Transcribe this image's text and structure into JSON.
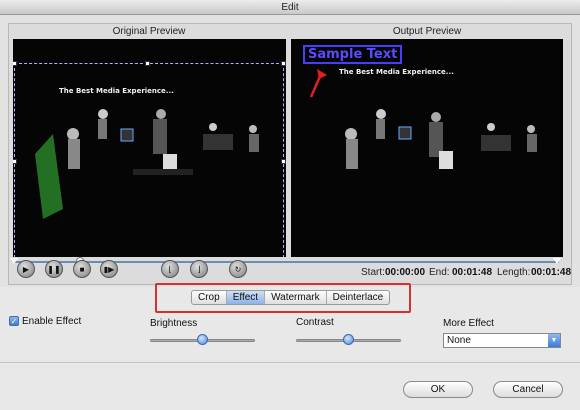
{
  "window": {
    "title": "Edit"
  },
  "preview": {
    "original_label": "Original Preview",
    "output_label": "Output Preview",
    "video_caption": "The Best Media Experience...",
    "watermark_text": "Sample Text"
  },
  "playback": {
    "start_label": "Start:",
    "start_value": "00:00:00",
    "end_label": "End:",
    "end_value": "00:01:48",
    "length_label": "Length:",
    "length_value": "00:01:48"
  },
  "tabs": [
    {
      "label": "Crop",
      "active": false
    },
    {
      "label": "Effect",
      "active": true
    },
    {
      "label": "Watermark",
      "active": false
    },
    {
      "label": "Deinterlace",
      "active": false
    }
  ],
  "effect": {
    "enable_label": "Enable Effect",
    "enabled": true,
    "brightness_label": "Brightness",
    "brightness_value": 0.5,
    "contrast_label": "Contrast",
    "contrast_value": 0.5,
    "more_effect_label": "More Effect",
    "more_effect_value": "None"
  },
  "buttons": {
    "ok": "OK",
    "cancel": "Cancel"
  },
  "colors": {
    "accent": "#3d7bd6",
    "highlight_border": "#d63030",
    "watermark": "#4a3cff"
  }
}
